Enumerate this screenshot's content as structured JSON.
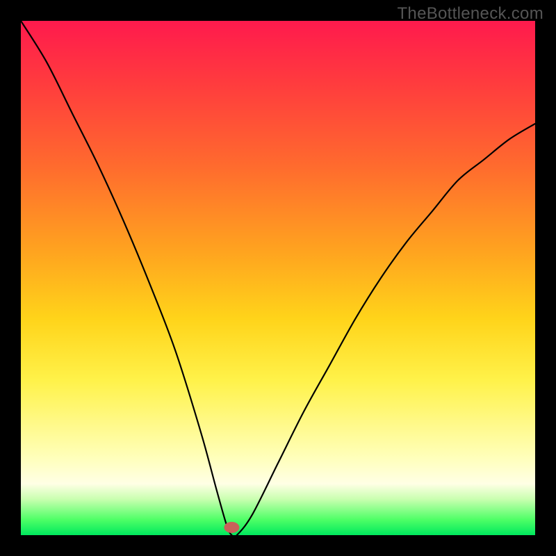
{
  "watermark": "TheBottleneck.com",
  "chart_data": {
    "type": "line",
    "title": "",
    "xlabel": "",
    "ylabel": "",
    "xlim": [
      0,
      100
    ],
    "ylim": [
      0,
      100
    ],
    "series": [
      {
        "name": "bottleneck-curve",
        "x": [
          0,
          5,
          10,
          15,
          20,
          25,
          30,
          35,
          38,
          40,
          41,
          42,
          45,
          50,
          55,
          60,
          65,
          70,
          75,
          80,
          85,
          90,
          95,
          100
        ],
        "values": [
          100,
          92,
          82,
          72,
          61,
          49,
          36,
          20,
          9,
          2,
          0,
          0,
          4,
          14,
          24,
          33,
          42,
          50,
          57,
          63,
          69,
          73,
          77,
          80
        ]
      }
    ],
    "marker": {
      "x": 41,
      "y": 1.5,
      "name": "optimal-point"
    },
    "colors": {
      "gradient_top": "#ff1a4d",
      "gradient_mid": "#ffd41a",
      "gradient_bottom": "#00e85e",
      "curve": "#000000",
      "marker": "#c9615a",
      "frame": "#000000"
    }
  }
}
